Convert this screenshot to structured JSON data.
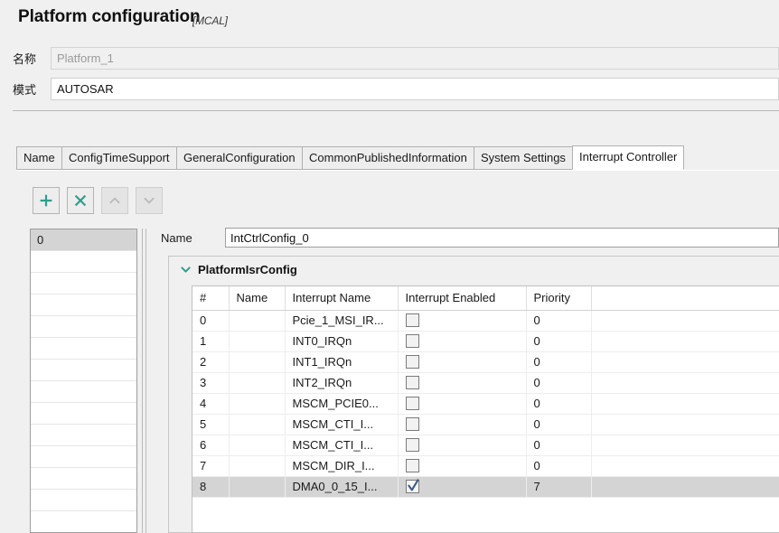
{
  "header": {
    "title": "Platform configuration",
    "title_suffix": "[MCAL]",
    "fields": [
      {
        "label": "名称",
        "value": "Platform_1",
        "disabled": true
      },
      {
        "label": "模式",
        "value": "AUTOSAR",
        "disabled": false
      }
    ]
  },
  "tabs": [
    {
      "label": "Name",
      "selected": false
    },
    {
      "label": "ConfigTimeSupport",
      "selected": false
    },
    {
      "label": "GeneralConfiguration",
      "selected": false
    },
    {
      "label": "CommonPublishedInformation",
      "selected": false
    },
    {
      "label": "System Settings",
      "selected": false
    },
    {
      "label": "Interrupt Controller",
      "selected": true
    }
  ],
  "toolbar": {
    "add_label": "+",
    "delete_label": "×",
    "move_up_label": "^",
    "move_down_label": "v",
    "accent_color": "#2f9e8f",
    "disabled_color": "#b9b9b9"
  },
  "list_panel": {
    "items": [
      "0"
    ],
    "selected_index": 0,
    "blank_rows": 13
  },
  "detail": {
    "name_label": "Name",
    "name_value": "IntCtrlConfig_0",
    "group": {
      "title": "PlatformIsrConfig",
      "expanded": true,
      "chevron_color": "#2f9e8f"
    }
  },
  "table": {
    "columns": [
      "#",
      "Name",
      "Interrupt Name",
      "Interrupt Enabled",
      "Priority",
      ""
    ],
    "rows": [
      {
        "index": "0",
        "name": "",
        "interrupt_name": "Pcie_1_MSI_IR...",
        "enabled": false,
        "priority": "0",
        "selected": false
      },
      {
        "index": "1",
        "name": "",
        "interrupt_name": "INT0_IRQn",
        "enabled": false,
        "priority": "0",
        "selected": false
      },
      {
        "index": "2",
        "name": "",
        "interrupt_name": "INT1_IRQn",
        "enabled": false,
        "priority": "0",
        "selected": false
      },
      {
        "index": "3",
        "name": "",
        "interrupt_name": "INT2_IRQn",
        "enabled": false,
        "priority": "0",
        "selected": false
      },
      {
        "index": "4",
        "name": "",
        "interrupt_name": "MSCM_PCIE0...",
        "enabled": false,
        "priority": "0",
        "selected": false
      },
      {
        "index": "5",
        "name": "",
        "interrupt_name": "MSCM_CTI_I...",
        "enabled": false,
        "priority": "0",
        "selected": false
      },
      {
        "index": "6",
        "name": "",
        "interrupt_name": "MSCM_CTI_I...",
        "enabled": false,
        "priority": "0",
        "selected": false
      },
      {
        "index": "7",
        "name": "",
        "interrupt_name": "MSCM_DIR_I...",
        "enabled": false,
        "priority": "0",
        "selected": false
      },
      {
        "index": "8",
        "name": "",
        "interrupt_name": "DMA0_0_15_I...",
        "enabled": true,
        "priority": "7",
        "selected": true
      }
    ],
    "checkmark_color": "#3a5b92"
  }
}
